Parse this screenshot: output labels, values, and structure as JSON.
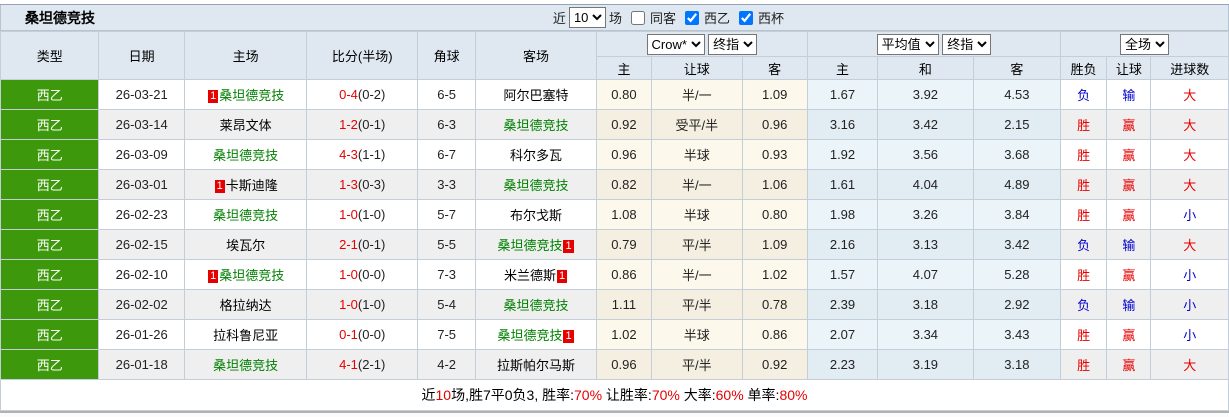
{
  "title": "桑坦德竞技",
  "colors": {
    "league_badge_green": "#3d990b",
    "team_highlight_green": "#008000",
    "win_red": "#e60000",
    "lose_blue": "#0000cc",
    "header_bg": "#dfe8f1"
  },
  "filters": {
    "near_label": "近",
    "games_value": "10",
    "games_suffix": "场",
    "same_venue_label": "同客",
    "same_venue_checked": false,
    "league_label": "西乙",
    "league_checked": true,
    "cup_label": "西杯",
    "cup_checked": true
  },
  "selects": {
    "bookmaker": "Crow*",
    "bookmaker_stage": "终指",
    "average": "平均值",
    "average_stage": "终指",
    "scope": "全场"
  },
  "columns": {
    "type": "类型",
    "date": "日期",
    "home": "主场",
    "score": "比分(半场)",
    "corner": "角球",
    "away": "客场",
    "odds_home": "主",
    "odds_handicap": "让球",
    "odds_away": "客",
    "avg_home": "主",
    "avg_draw": "和",
    "avg_away": "客",
    "result_wdl": "胜负",
    "result_handicap": "让球",
    "result_goals": "进球数"
  },
  "rows": [
    {
      "league": "西乙",
      "date": "26-03-21",
      "home": "桑坦德竞技",
      "home_green": true,
      "home_badge": "1",
      "away": "阿尔巴塞特",
      "away_green": false,
      "away_badge": null,
      "score_ft": "0-4",
      "score_ht": "(0-2)",
      "corner": "6-5",
      "odds": [
        "0.80",
        "半/一",
        "1.09"
      ],
      "avg": [
        "1.67",
        "3.92",
        "4.53"
      ],
      "wdl": "负",
      "wdl_color": "blue",
      "handicap": "输",
      "handicap_color": "blue",
      "goals": "大",
      "goals_color": "red"
    },
    {
      "league": "西乙",
      "date": "26-03-14",
      "home": "莱昂文体",
      "home_green": false,
      "home_badge": null,
      "away": "桑坦德竞技",
      "away_green": true,
      "away_badge": null,
      "score_ft": "1-2",
      "score_ht": "(0-1)",
      "corner": "6-3",
      "odds": [
        "0.92",
        "受平/半",
        "0.96"
      ],
      "avg": [
        "3.16",
        "3.42",
        "2.15"
      ],
      "wdl": "胜",
      "wdl_color": "red",
      "handicap": "赢",
      "handicap_color": "red",
      "goals": "大",
      "goals_color": "red"
    },
    {
      "league": "西乙",
      "date": "26-03-09",
      "home": "桑坦德竞技",
      "home_green": true,
      "home_badge": null,
      "away": "科尔多瓦",
      "away_green": false,
      "away_badge": null,
      "score_ft": "4-3",
      "score_ht": "(1-1)",
      "corner": "6-7",
      "odds": [
        "0.96",
        "半球",
        "0.93"
      ],
      "avg": [
        "1.92",
        "3.56",
        "3.68"
      ],
      "wdl": "胜",
      "wdl_color": "red",
      "handicap": "赢",
      "handicap_color": "red",
      "goals": "大",
      "goals_color": "red"
    },
    {
      "league": "西乙",
      "date": "26-03-01",
      "home": "卡斯迪隆",
      "home_green": false,
      "home_badge": "1",
      "away": "桑坦德竞技",
      "away_green": true,
      "away_badge": null,
      "score_ft": "1-3",
      "score_ht": "(0-3)",
      "corner": "3-3",
      "odds": [
        "0.82",
        "半/一",
        "1.06"
      ],
      "avg": [
        "1.61",
        "4.04",
        "4.89"
      ],
      "wdl": "胜",
      "wdl_color": "red",
      "handicap": "赢",
      "handicap_color": "red",
      "goals": "大",
      "goals_color": "red"
    },
    {
      "league": "西乙",
      "date": "26-02-23",
      "home": "桑坦德竞技",
      "home_green": true,
      "home_badge": null,
      "away": "布尔戈斯",
      "away_green": false,
      "away_badge": null,
      "score_ft": "1-0",
      "score_ht": "(1-0)",
      "corner": "5-7",
      "odds": [
        "1.08",
        "半球",
        "0.80"
      ],
      "avg": [
        "1.98",
        "3.26",
        "3.84"
      ],
      "wdl": "胜",
      "wdl_color": "red",
      "handicap": "赢",
      "handicap_color": "red",
      "goals": "小",
      "goals_color": "blue"
    },
    {
      "league": "西乙",
      "date": "26-02-15",
      "home": "埃瓦尔",
      "home_green": false,
      "home_badge": null,
      "away": "桑坦德竞技",
      "away_green": true,
      "away_badge": "1",
      "score_ft": "2-1",
      "score_ht": "(0-1)",
      "corner": "5-5",
      "odds": [
        "0.79",
        "平/半",
        "1.09"
      ],
      "avg": [
        "2.16",
        "3.13",
        "3.42"
      ],
      "wdl": "负",
      "wdl_color": "blue",
      "handicap": "输",
      "handicap_color": "blue",
      "goals": "大",
      "goals_color": "red"
    },
    {
      "league": "西乙",
      "date": "26-02-10",
      "home": "桑坦德竞技",
      "home_green": true,
      "home_badge": "1",
      "away": "米兰德斯",
      "away_green": false,
      "away_badge": "1",
      "score_ft": "1-0",
      "score_ht": "(0-0)",
      "corner": "7-3",
      "odds": [
        "0.86",
        "半/一",
        "1.02"
      ],
      "avg": [
        "1.57",
        "4.07",
        "5.28"
      ],
      "wdl": "胜",
      "wdl_color": "red",
      "handicap": "赢",
      "handicap_color": "red",
      "goals": "小",
      "goals_color": "blue"
    },
    {
      "league": "西乙",
      "date": "26-02-02",
      "home": "格拉纳达",
      "home_green": false,
      "home_badge": null,
      "away": "桑坦德竞技",
      "away_green": true,
      "away_badge": null,
      "score_ft": "1-0",
      "score_ht": "(1-0)",
      "corner": "5-4",
      "odds": [
        "1.11",
        "平/半",
        "0.78"
      ],
      "avg": [
        "2.39",
        "3.18",
        "2.92"
      ],
      "wdl": "负",
      "wdl_color": "blue",
      "handicap": "输",
      "handicap_color": "blue",
      "goals": "小",
      "goals_color": "blue"
    },
    {
      "league": "西乙",
      "date": "26-01-26",
      "home": "拉科鲁尼亚",
      "home_green": false,
      "home_badge": null,
      "away": "桑坦德竞技",
      "away_green": true,
      "away_badge": "1",
      "score_ft": "0-1",
      "score_ht": "(0-0)",
      "corner": "7-5",
      "odds": [
        "1.02",
        "半球",
        "0.86"
      ],
      "avg": [
        "2.07",
        "3.34",
        "3.43"
      ],
      "wdl": "胜",
      "wdl_color": "red",
      "handicap": "赢",
      "handicap_color": "red",
      "goals": "小",
      "goals_color": "blue"
    },
    {
      "league": "西乙",
      "date": "26-01-18",
      "home": "桑坦德竞技",
      "home_green": true,
      "home_badge": null,
      "away": "拉斯帕尔马斯",
      "away_green": false,
      "away_badge": null,
      "score_ft": "4-1",
      "score_ht": "(2-1)",
      "corner": "4-2",
      "odds": [
        "0.96",
        "平/半",
        "0.92"
      ],
      "avg": [
        "2.23",
        "3.19",
        "3.18"
      ],
      "wdl": "胜",
      "wdl_color": "red",
      "handicap": "赢",
      "handicap_color": "red",
      "goals": "大",
      "goals_color": "red"
    }
  ],
  "footer": {
    "segments": [
      {
        "text": "近",
        "red": false
      },
      {
        "text": "10",
        "red": true
      },
      {
        "text": "场,胜7平0负3, 胜率:",
        "red": false
      },
      {
        "text": "70%",
        "red": true
      },
      {
        "text": " 让胜率:",
        "red": false
      },
      {
        "text": "70%",
        "red": true
      },
      {
        "text": " 大率:",
        "red": false
      },
      {
        "text": "60%",
        "red": true
      },
      {
        "text": " 单率:",
        "red": false
      },
      {
        "text": "80%",
        "red": true
      }
    ]
  }
}
